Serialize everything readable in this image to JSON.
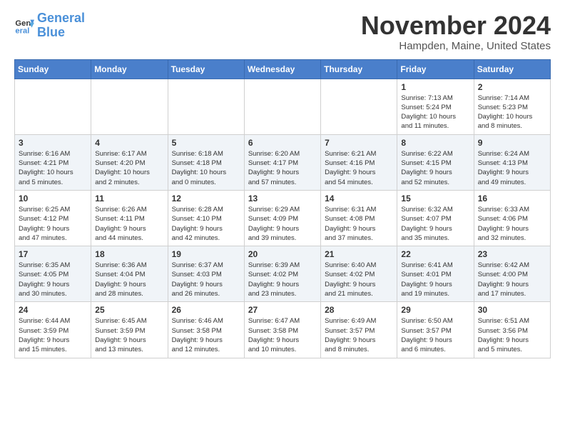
{
  "logo": {
    "line1": "General",
    "line2": "Blue"
  },
  "title": "November 2024",
  "location": "Hampden, Maine, United States",
  "days_of_week": [
    "Sunday",
    "Monday",
    "Tuesday",
    "Wednesday",
    "Thursday",
    "Friday",
    "Saturday"
  ],
  "weeks": [
    [
      {
        "day": "",
        "info": ""
      },
      {
        "day": "",
        "info": ""
      },
      {
        "day": "",
        "info": ""
      },
      {
        "day": "",
        "info": ""
      },
      {
        "day": "",
        "info": ""
      },
      {
        "day": "1",
        "info": "Sunrise: 7:13 AM\nSunset: 5:24 PM\nDaylight: 10 hours\nand 11 minutes."
      },
      {
        "day": "2",
        "info": "Sunrise: 7:14 AM\nSunset: 5:23 PM\nDaylight: 10 hours\nand 8 minutes."
      }
    ],
    [
      {
        "day": "3",
        "info": "Sunrise: 6:16 AM\nSunset: 4:21 PM\nDaylight: 10 hours\nand 5 minutes."
      },
      {
        "day": "4",
        "info": "Sunrise: 6:17 AM\nSunset: 4:20 PM\nDaylight: 10 hours\nand 2 minutes."
      },
      {
        "day": "5",
        "info": "Sunrise: 6:18 AM\nSunset: 4:18 PM\nDaylight: 10 hours\nand 0 minutes."
      },
      {
        "day": "6",
        "info": "Sunrise: 6:20 AM\nSunset: 4:17 PM\nDaylight: 9 hours\nand 57 minutes."
      },
      {
        "day": "7",
        "info": "Sunrise: 6:21 AM\nSunset: 4:16 PM\nDaylight: 9 hours\nand 54 minutes."
      },
      {
        "day": "8",
        "info": "Sunrise: 6:22 AM\nSunset: 4:15 PM\nDaylight: 9 hours\nand 52 minutes."
      },
      {
        "day": "9",
        "info": "Sunrise: 6:24 AM\nSunset: 4:13 PM\nDaylight: 9 hours\nand 49 minutes."
      }
    ],
    [
      {
        "day": "10",
        "info": "Sunrise: 6:25 AM\nSunset: 4:12 PM\nDaylight: 9 hours\nand 47 minutes."
      },
      {
        "day": "11",
        "info": "Sunrise: 6:26 AM\nSunset: 4:11 PM\nDaylight: 9 hours\nand 44 minutes."
      },
      {
        "day": "12",
        "info": "Sunrise: 6:28 AM\nSunset: 4:10 PM\nDaylight: 9 hours\nand 42 minutes."
      },
      {
        "day": "13",
        "info": "Sunrise: 6:29 AM\nSunset: 4:09 PM\nDaylight: 9 hours\nand 39 minutes."
      },
      {
        "day": "14",
        "info": "Sunrise: 6:31 AM\nSunset: 4:08 PM\nDaylight: 9 hours\nand 37 minutes."
      },
      {
        "day": "15",
        "info": "Sunrise: 6:32 AM\nSunset: 4:07 PM\nDaylight: 9 hours\nand 35 minutes."
      },
      {
        "day": "16",
        "info": "Sunrise: 6:33 AM\nSunset: 4:06 PM\nDaylight: 9 hours\nand 32 minutes."
      }
    ],
    [
      {
        "day": "17",
        "info": "Sunrise: 6:35 AM\nSunset: 4:05 PM\nDaylight: 9 hours\nand 30 minutes."
      },
      {
        "day": "18",
        "info": "Sunrise: 6:36 AM\nSunset: 4:04 PM\nDaylight: 9 hours\nand 28 minutes."
      },
      {
        "day": "19",
        "info": "Sunrise: 6:37 AM\nSunset: 4:03 PM\nDaylight: 9 hours\nand 26 minutes."
      },
      {
        "day": "20",
        "info": "Sunrise: 6:39 AM\nSunset: 4:02 PM\nDaylight: 9 hours\nand 23 minutes."
      },
      {
        "day": "21",
        "info": "Sunrise: 6:40 AM\nSunset: 4:02 PM\nDaylight: 9 hours\nand 21 minutes."
      },
      {
        "day": "22",
        "info": "Sunrise: 6:41 AM\nSunset: 4:01 PM\nDaylight: 9 hours\nand 19 minutes."
      },
      {
        "day": "23",
        "info": "Sunrise: 6:42 AM\nSunset: 4:00 PM\nDaylight: 9 hours\nand 17 minutes."
      }
    ],
    [
      {
        "day": "24",
        "info": "Sunrise: 6:44 AM\nSunset: 3:59 PM\nDaylight: 9 hours\nand 15 minutes."
      },
      {
        "day": "25",
        "info": "Sunrise: 6:45 AM\nSunset: 3:59 PM\nDaylight: 9 hours\nand 13 minutes."
      },
      {
        "day": "26",
        "info": "Sunrise: 6:46 AM\nSunset: 3:58 PM\nDaylight: 9 hours\nand 12 minutes."
      },
      {
        "day": "27",
        "info": "Sunrise: 6:47 AM\nSunset: 3:58 PM\nDaylight: 9 hours\nand 10 minutes."
      },
      {
        "day": "28",
        "info": "Sunrise: 6:49 AM\nSunset: 3:57 PM\nDaylight: 9 hours\nand 8 minutes."
      },
      {
        "day": "29",
        "info": "Sunrise: 6:50 AM\nSunset: 3:57 PM\nDaylight: 9 hours\nand 6 minutes."
      },
      {
        "day": "30",
        "info": "Sunrise: 6:51 AM\nSunset: 3:56 PM\nDaylight: 9 hours\nand 5 minutes."
      }
    ]
  ]
}
